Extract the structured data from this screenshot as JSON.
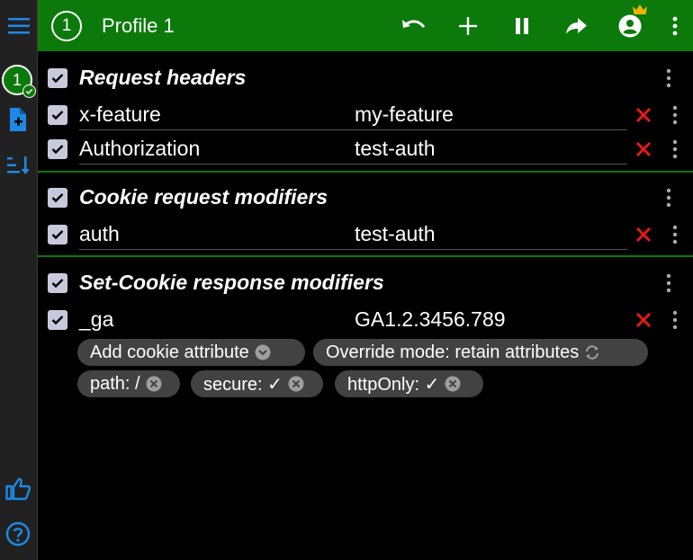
{
  "topbar": {
    "profile_number": "1",
    "title": "Profile 1"
  },
  "rail": {
    "profile_number": "1"
  },
  "sections": {
    "request_headers": {
      "title": "Request headers",
      "rows": [
        {
          "name": "x-feature",
          "value": "my-feature"
        },
        {
          "name": "Authorization",
          "value": "test-auth"
        }
      ]
    },
    "cookie_request": {
      "title": "Cookie request modifiers",
      "rows": [
        {
          "name": "auth",
          "value": "test-auth"
        }
      ]
    },
    "set_cookie_response": {
      "title": "Set-Cookie response modifiers",
      "rows": [
        {
          "name": "_ga",
          "value": "GA1.2.3456.789"
        }
      ],
      "chips": {
        "add_attribute": "Add cookie attribute",
        "override_mode": "Override mode: retain attributes",
        "path": "path: /",
        "secure": "secure: ✓",
        "httponly": "httpOnly: ✓"
      }
    }
  },
  "colors": {
    "accent_green": "#0b7a0b",
    "delete_red": "#e31a1a",
    "rail_icon_blue": "#1e88e5",
    "crown_gold": "#f4b400"
  },
  "icons": {
    "menu": "menu-icon",
    "undo": "undo-icon",
    "add": "add-icon",
    "pause": "pause-icon",
    "share": "share-icon",
    "account": "account-circle-icon",
    "crown": "crown-icon",
    "more": "more-vert-icon",
    "add_file": "add-file-icon",
    "sort": "sort-icon",
    "thumb_up": "thumb-up-icon",
    "help": "help-icon",
    "delete": "close-icon",
    "checkbox": "checkbox-checked-icon"
  }
}
